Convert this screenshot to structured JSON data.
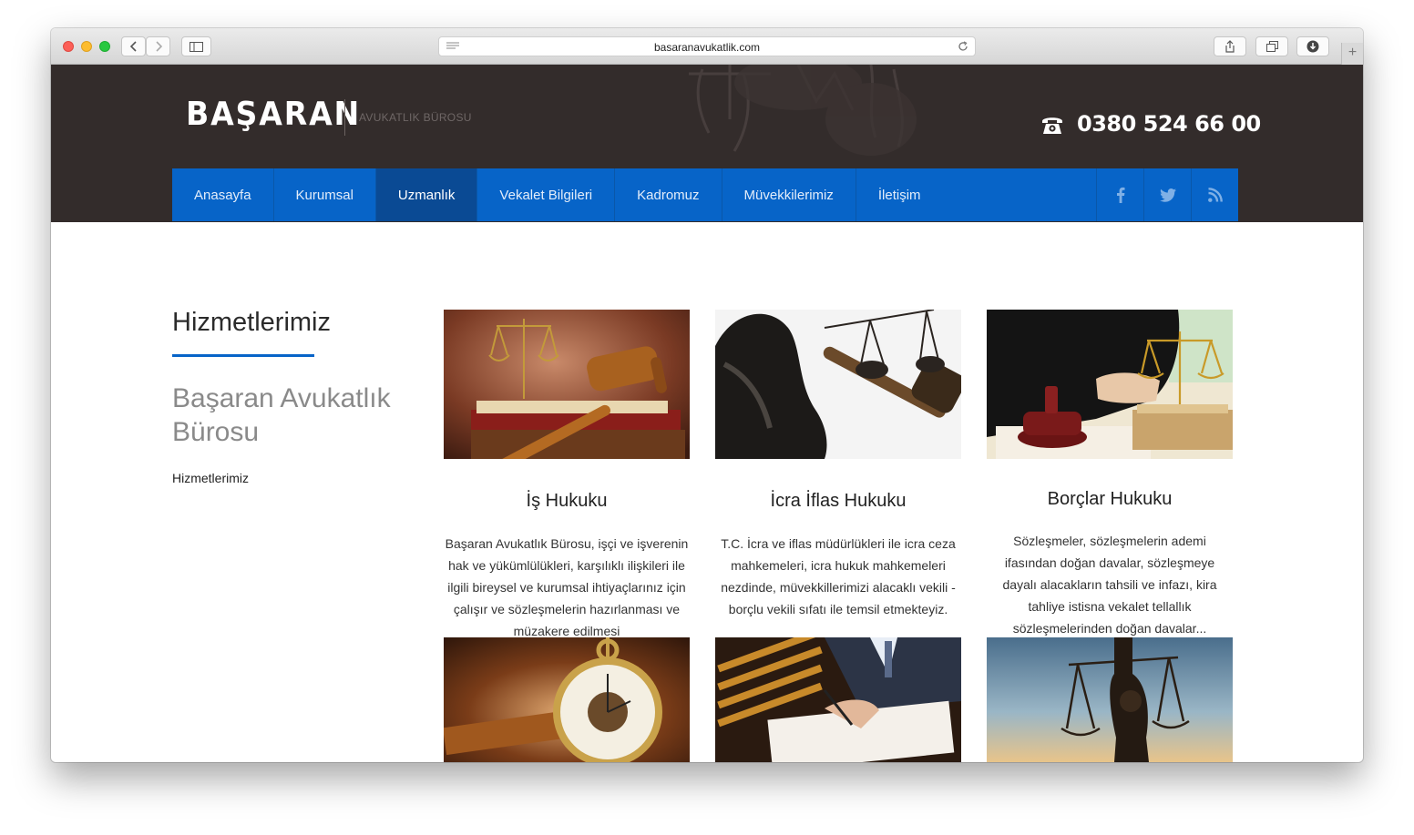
{
  "browser": {
    "url": "basaranavukatlik.com"
  },
  "header": {
    "logo": "BAŞARAN",
    "tagline": "AVUKATLIK BÜROSU",
    "phone": "0380 524 66 00"
  },
  "nav": {
    "items": [
      {
        "label": "Anasayfa"
      },
      {
        "label": "Kurumsal"
      },
      {
        "label": "Uzmanlık",
        "active": true
      },
      {
        "label": "Vekalet Bilgileri"
      },
      {
        "label": "Kadromuz"
      },
      {
        "label": "Müvekkilerimiz"
      },
      {
        "label": "İletişim"
      }
    ],
    "social": [
      "facebook-icon",
      "twitter-icon",
      "rss-icon"
    ]
  },
  "sidebar": {
    "title": "Hizmetlerimiz",
    "firm": "Başaran Avukatlık Bürosu",
    "link": "Hizmetlerimiz"
  },
  "cards": [
    {
      "title": "İş Hukuku",
      "text": "Başaran Avukatlık Bürosu, işçi ve işverenin hak ve yükümlülükleri, karşılıklı ilişkileri ile ilgili bireysel ve kurumsal ihtiyaçlarınız için çalışır ve sözleşmelerin hazırlanması ve müzakere edilmesi"
    },
    {
      "title": "İcra İflas Hukuku",
      "text": "T.C. İcra ve iflas müdürlükleri ile icra ceza mahkemeleri, icra hukuk mahkemeleri nezdinde, müvekkillerimizi alacaklı vekili - borçlu vekili sıfatı ile temsil etmekteyiz."
    },
    {
      "title": "Borçlar Hukuku",
      "text": "Sözleşmeler, sözleşmelerin ademi ifasından doğan davalar, sözleşmeye dayalı alacakların tahsili ve infazı, kira tahliye istisna vekalet tellallık sözleşmelerinden doğan davalar..."
    }
  ],
  "colors": {
    "header_bg": "#332c2b",
    "nav_bg": "#0764c8",
    "nav_active": "#0a4a94",
    "accent_rule": "#0764c8"
  }
}
